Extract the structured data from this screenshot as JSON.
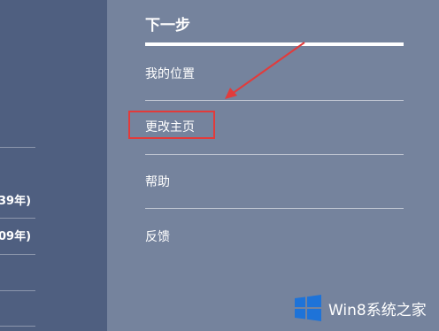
{
  "left_panel": {
    "year_items": [
      "39年)",
      "09年)"
    ]
  },
  "menu": {
    "title": "下一步",
    "items": [
      {
        "label": "我的位置"
      },
      {
        "label": "更改主页"
      },
      {
        "label": "帮助"
      },
      {
        "label": "反馈"
      }
    ]
  },
  "annotation": {
    "highlight_color": "#e23b3b"
  },
  "watermark": {
    "text": "Win8系统之家",
    "logo": "windows-logo-icon"
  },
  "colors": {
    "left_panel_bg": "#4f5f80",
    "right_panel_bg": "#75839d",
    "text": "#ffffff"
  }
}
